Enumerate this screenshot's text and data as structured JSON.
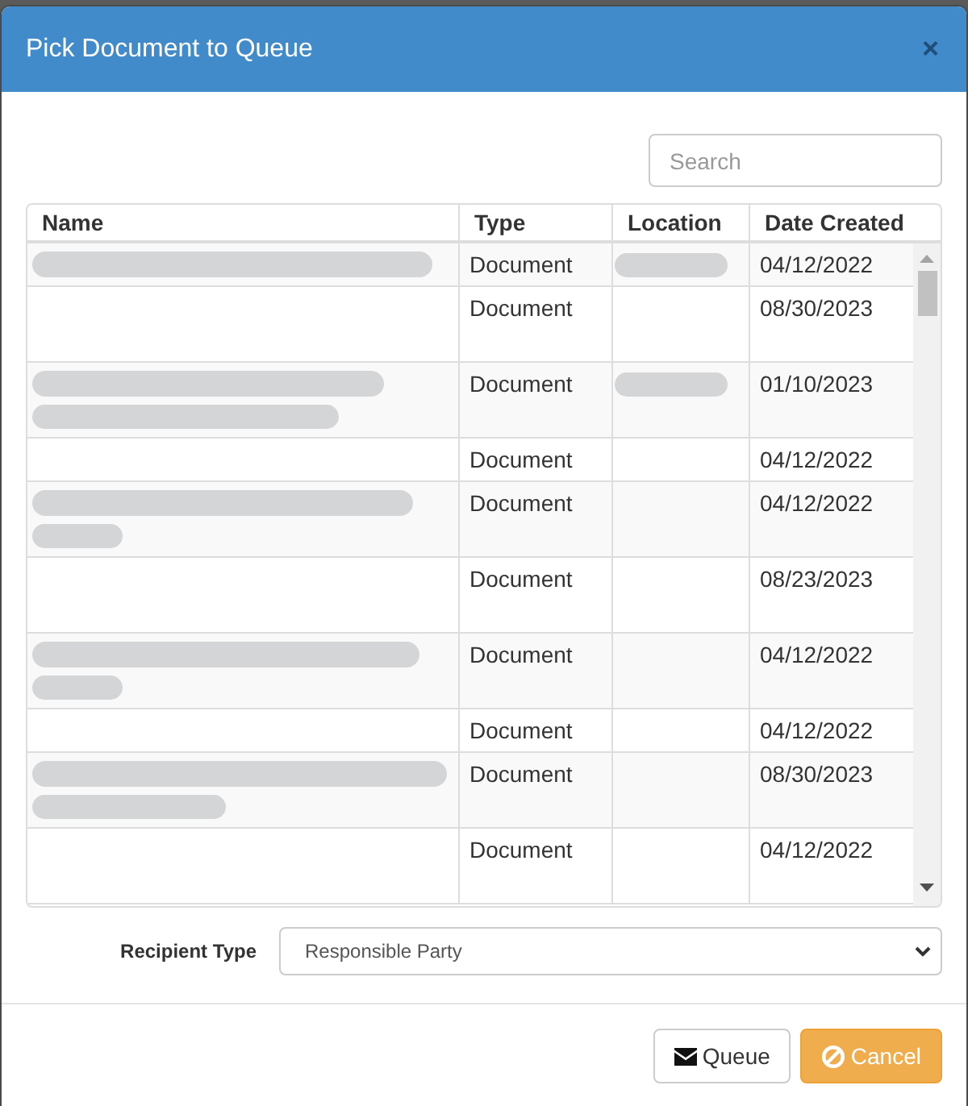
{
  "dialog": {
    "title": "Pick Document to Queue",
    "close": "×"
  },
  "search": {
    "placeholder": "Search"
  },
  "table": {
    "columns": [
      "Name",
      "Type",
      "Location",
      "Date Created"
    ],
    "rows": [
      {
        "kind": "one-line",
        "name_redacted": true,
        "type": "Document",
        "location_redacted": true,
        "date_created": "04/12/2022"
      },
      {
        "kind": "two-line",
        "name_redacted": false,
        "type": "Document",
        "location_redacted": false,
        "date_created": "08/30/2023"
      },
      {
        "kind": "two-line",
        "name_redacted": true,
        "type": "Document",
        "location_redacted": true,
        "date_created": "01/10/2023"
      },
      {
        "kind": "one-line",
        "name_redacted": false,
        "type": "Document",
        "location_redacted": false,
        "date_created": "04/12/2022"
      },
      {
        "kind": "two-line",
        "name_redacted": true,
        "type": "Document",
        "location_redacted": false,
        "date_created": "04/12/2022"
      },
      {
        "kind": "two-line",
        "name_redacted": false,
        "type": "Document",
        "location_redacted": false,
        "date_created": "08/23/2023"
      },
      {
        "kind": "two-line",
        "name_redacted": true,
        "type": "Document",
        "location_redacted": false,
        "date_created": "04/12/2022"
      },
      {
        "kind": "one-line",
        "name_redacted": false,
        "type": "Document",
        "location_redacted": false,
        "date_created": "04/12/2022"
      },
      {
        "kind": "two-line",
        "name_redacted": true,
        "type": "Document",
        "location_redacted": false,
        "date_created": "08/30/2023"
      },
      {
        "kind": "two-line",
        "name_redacted": false,
        "type": "Document",
        "location_redacted": false,
        "date_created": "04/12/2022"
      }
    ]
  },
  "recipient_type": {
    "label": "Recipient Type",
    "value": "Responsible Party"
  },
  "buttons": [
    {
      "kind": "queue",
      "label": "Queue"
    },
    {
      "kind": "cancel",
      "label": "Cancel"
    }
  ]
}
